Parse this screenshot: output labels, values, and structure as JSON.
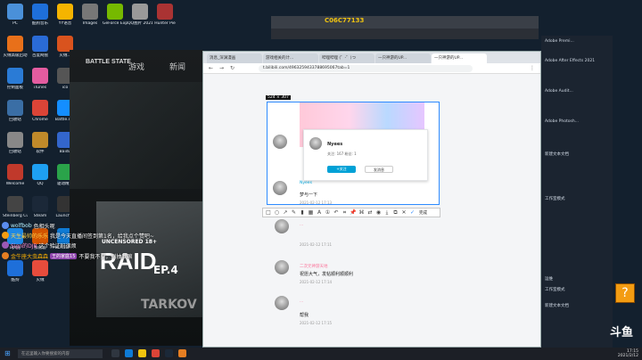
{
  "colors": {
    "accent": "#00a1d6",
    "pink": "#fb7299",
    "capture_border": "#2e8bff"
  },
  "back_window": {
    "title": "C06C77133"
  },
  "launcher": {
    "logo": "BATTLE STATE",
    "nav": [
      "游戏",
      "新闻"
    ],
    "promo_tag": "UNCENSORED 18+",
    "promo_title": "RAID",
    "promo_ep": "EP.4",
    "promo_sub": "TARKOV"
  },
  "desktop_left": [
    {
      "label": "PC",
      "color": "#4a90d9"
    },
    {
      "label": "酷狗音乐",
      "color": "#1e6fd9"
    },
    {
      "label": "YY语音",
      "color": "#f5b400"
    },
    {
      "label": "Images",
      "color": "#777"
    },
    {
      "label": "GeForce Experience",
      "color": "#76b900"
    },
    {
      "label": "QQ图片 20210216",
      "color": "#999"
    },
    {
      "label": "Hunter Pie",
      "color": "#aa3333"
    },
    {
      "label": "火绒高级启动",
      "color": "#e8701a"
    },
    {
      "label": "百度网盘",
      "color": "#2a6bd6"
    },
    {
      "label": "火绒...",
      "color": "#d9531e"
    },
    {
      "label": "控制面板",
      "color": "#2a7bd6"
    },
    {
      "label": "iTunes",
      "color": "#e45ca0"
    },
    {
      "label": "ico",
      "color": "#555"
    },
    {
      "label": "回收站",
      "color": "#3a6ea5"
    },
    {
      "label": "Chrome",
      "color": "#db4437"
    },
    {
      "label": "Battle.net",
      "color": "#148eff"
    },
    {
      "label": "回收站",
      "color": "#888"
    },
    {
      "label": "软件",
      "color": "#c08a2a"
    },
    {
      "label": "Baidu",
      "color": "#3366cc"
    },
    {
      "label": "Welcome",
      "color": "#c0392b"
    },
    {
      "label": "QQ",
      "color": "#1ea0f2"
    },
    {
      "label": "驱动精灵",
      "color": "#2aa34a"
    },
    {
      "label": "Steinberg Cubase 5",
      "color": "#444"
    },
    {
      "label": "Steam",
      "color": "#1b2838"
    },
    {
      "label": "Launcher",
      "color": "#333"
    },
    {
      "label": "Uplay",
      "color": "#1e88e5"
    },
    {
      "label": "加速器",
      "color": "#d35400"
    },
    {
      "label": "Microsoft Edge",
      "color": "#0f7bd6"
    },
    {
      "label": "酷狗",
      "color": "#1e6fd9"
    },
    {
      "label": "火绒",
      "color": "#e74c3c"
    }
  ],
  "chat": [
    {
      "name": "wolfbob",
      "text": "色相头呢",
      "name_color": "#b7f1ff",
      "avatar": "#5b8def"
    },
    {
      "name": "天生最帅的乐乐",
      "text": "我是今天直播间签到第1名，给我点个赞吧~",
      "name_color": "#ffd24a",
      "avatar": "#f39c12"
    },
    {
      "name": "Sign的DJB",
      "text": "这个验证码很烦",
      "name_color": "#ff8ad1",
      "avatar": "#9b59b6"
    },
    {
      "name": "金牛座大虫森森",
      "badge": "王的家庭15",
      "text": "不要我不要，别抽我嘛",
      "name_color": "#ffb300",
      "avatar": "#e67e22"
    }
  ],
  "browser": {
    "tabs": [
      "消息_深渊漫画",
      "游戏相关的计...",
      "哔哩哔哩 (゜-゜)つ",
      "一只神游的UP...",
      "一只神游的UP..."
    ],
    "url": "t.bilibili.com/4963259433788695067tab=1"
  },
  "capture": {
    "size": "524 × 307",
    "nick": "Nyees",
    "stats": "关注: 167    粉丝: 1",
    "follow": "+关注",
    "message": "发消息",
    "reply_name": "Nyees",
    "reply_text": "梦与一下",
    "reply_meta": "2021-02-12 17:13"
  },
  "toolbar": {
    "done": "完成"
  },
  "comments": [
    {
      "name": "...",
      "text": "",
      "meta": "2021-02-12 17:11"
    },
    {
      "name": "二次元神游天地",
      "text": "祝愿大气，发帖顺利顺顺利",
      "meta": "2021-02-12 17:14"
    },
    {
      "name": "...",
      "text": "帮我",
      "meta": "2021-02-12 17:15"
    }
  ],
  "right_panel": [
    "Adobe Premi...",
    "Adobe After Effects 2021",
    "Adobe Audit...",
    "Adobe Photosh...",
    "新建文本文档",
    "工作室模式",
    "运维",
    "工作室模式",
    "新建文本文档"
  ],
  "taskbar": {
    "search_placeholder": "在这里输入你要搜索的内容",
    "time": "17:15",
    "date": "2021/2/12"
  },
  "brand": "斗鱼"
}
